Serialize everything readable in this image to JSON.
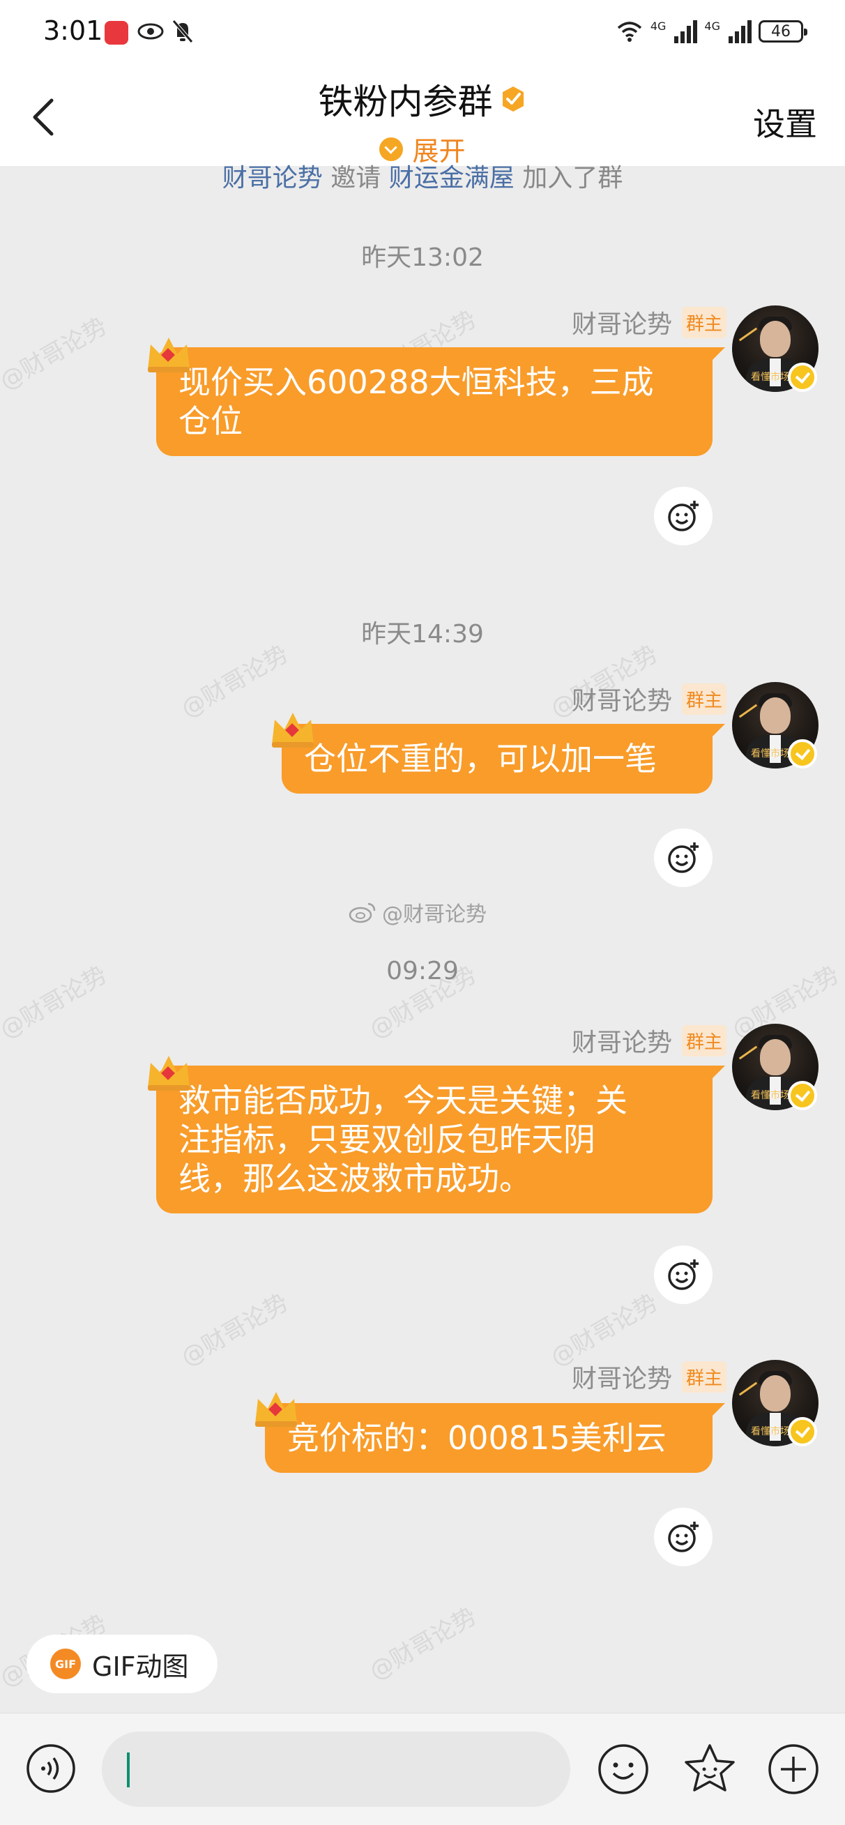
{
  "status_bar": {
    "time": "3:01",
    "network_a": "4G",
    "network_b": "4G",
    "battery": "46"
  },
  "header": {
    "title": "铁粉内参群",
    "expand_label": "展开",
    "settings_label": "设置"
  },
  "system_message": {
    "inviter": "财哥论势",
    "action": "邀请",
    "invitee": "财运金满屋",
    "suffix": "加入了群"
  },
  "messages": [
    {
      "time": "昨天13:02",
      "sender": "财哥论势",
      "role_badge": "群主",
      "text_lines": [
        "现价买入600288大恒科技，三成",
        "仓位"
      ]
    },
    {
      "time": "昨天14:39",
      "sender": "财哥论势",
      "role_badge": "群主",
      "text_lines": [
        "仓位不重的，可以加一笔"
      ]
    },
    {
      "time": "09:29",
      "sender": "财哥论势",
      "role_badge": "群主",
      "text_lines": [
        "救市能否成功，今天是关键；关",
        "注指标，只要双创反包昨天阴",
        "线，那么这波救市成功。"
      ]
    },
    {
      "time": "",
      "sender": "财哥论势",
      "role_badge": "群主",
      "text_lines": [
        "竞价标的：000815美利云"
      ]
    }
  ],
  "avatar_caption": "看懂市场势",
  "watermark_text": "@财哥论势",
  "gif_label": "GIF动图",
  "gif_icon_text": "GIF",
  "input": {
    "value": "",
    "placeholder": ""
  },
  "icons": {
    "back": "chevron-left-icon",
    "verified": "verified-badge-icon",
    "reaction": "add-reaction-icon",
    "voice": "voice-icon",
    "emoji": "emoji-icon",
    "sticker": "sticker-icon",
    "plus": "plus-icon",
    "crown": "crown-icon"
  },
  "colors": {
    "bubble": "#f99c2a",
    "accent": "#f0851f",
    "badge_bg": "#fbe6cf",
    "link": "#4a6fa5",
    "background": "#ececec"
  }
}
